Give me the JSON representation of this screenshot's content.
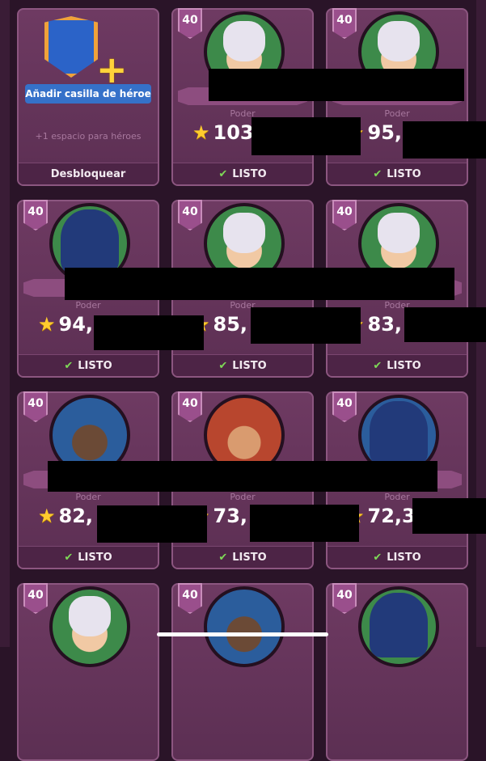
{
  "unlock_card": {
    "button_label": "Añadir casilla de héroe",
    "slot_info": "+1 espacio para héroes",
    "footer_label": "Desbloquear"
  },
  "power_label": "Poder",
  "heroes": [
    {
      "level": "40",
      "power": "103",
      "status": "LISTO",
      "portrait": "cat-mask-hero"
    },
    {
      "level": "40",
      "power": "95,",
      "status": "LISTO",
      "portrait": "cat-mask-hero"
    },
    {
      "level": "40",
      "power": "94,",
      "status": "LISTO",
      "portrait": "hooded-eyepatch-hero"
    },
    {
      "level": "40",
      "power": "85,",
      "status": "LISTO",
      "portrait": "cat-mask-hero"
    },
    {
      "level": "40",
      "power": "83,",
      "status": "LISTO",
      "portrait": "cat-mask-bearded-hero"
    },
    {
      "level": "40",
      "power": "82,",
      "status": "LISTO",
      "portrait": "silver-hair-hero"
    },
    {
      "level": "40",
      "power": "73,",
      "status": "LISTO",
      "portrait": "gold-helmet-hero"
    },
    {
      "level": "40",
      "power": "72,3",
      "status": "LISTO",
      "portrait": "hooded-eyepatch-hero"
    },
    {
      "level": "40",
      "portrait": "cat-mask-hero"
    },
    {
      "level": "40",
      "portrait": "hat-hero"
    },
    {
      "level": "40",
      "portrait": "hooded-eyepatch-hero"
    }
  ],
  "colors": {
    "card": "#6e3a62",
    "ready_check": "#7ed957",
    "star": "#ffcc2e",
    "level_badge": "#9a4f8c"
  }
}
